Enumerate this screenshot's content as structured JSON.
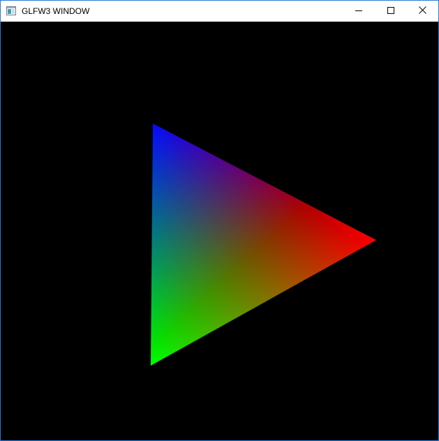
{
  "window": {
    "title": "GLFW3 WINDOW",
    "app_icon": "window-app-icon",
    "controls": {
      "minimize_icon": "minimize-icon",
      "maximize_icon": "maximize-icon",
      "close_icon": "close-icon"
    },
    "border_color": "#2b79d7"
  },
  "scene": {
    "background_color": "#000000",
    "triangle": {
      "vertex_colors": {
        "top": "#0000ff",
        "right": "#ff0000",
        "bottom": "#00ff00"
      }
    }
  }
}
